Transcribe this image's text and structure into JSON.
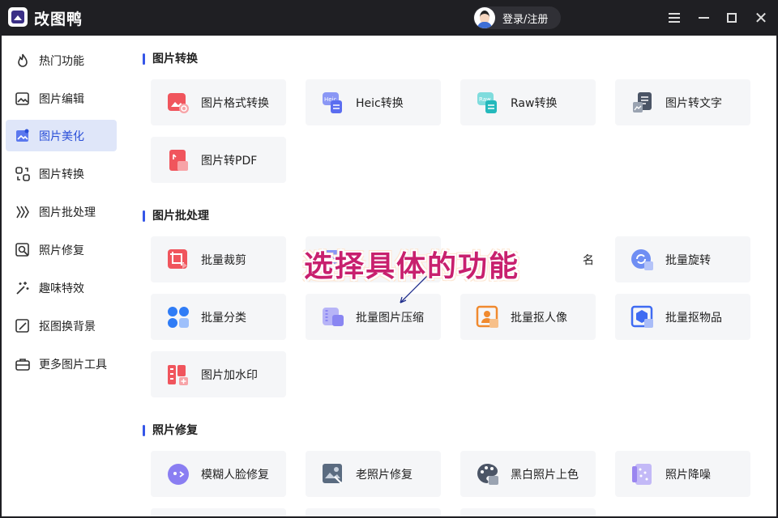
{
  "app": {
    "title": "改图鸭",
    "login_label": "登录/注册"
  },
  "window_controls": [
    "menu-icon",
    "minimize-icon",
    "maximize-icon",
    "close-icon"
  ],
  "sidebar": {
    "items": [
      {
        "label": "热门功能",
        "icon": "flame-icon",
        "active": false
      },
      {
        "label": "图片编辑",
        "icon": "image-edit-icon",
        "active": false
      },
      {
        "label": "图片美化",
        "icon": "image-beautify-icon",
        "active": true
      },
      {
        "label": "图片转换",
        "icon": "image-convert-icon",
        "active": false
      },
      {
        "label": "图片批处理",
        "icon": "batch-icon",
        "active": false
      },
      {
        "label": "照片修复",
        "icon": "photo-repair-icon",
        "active": false
      },
      {
        "label": "趣味特效",
        "icon": "magic-wand-icon",
        "active": false
      },
      {
        "label": "抠图换背景",
        "icon": "cutout-icon",
        "active": false
      },
      {
        "label": "更多图片工具",
        "icon": "toolbox-icon",
        "active": false
      }
    ]
  },
  "sections": [
    {
      "title": "图片转换",
      "cards": [
        {
          "label": "图片格式转换",
          "icon": "format-convert-icon",
          "color": "#f0555d"
        },
        {
          "label": "Heic转换",
          "icon": "heic-icon",
          "color": "#6b7ef0"
        },
        {
          "label": "Raw转换",
          "icon": "raw-icon",
          "color": "#2fc3c6"
        },
        {
          "label": "图片转文字",
          "icon": "image-to-text-icon",
          "color": "#4b5566"
        },
        {
          "label": "图片转PDF",
          "icon": "pdf-icon",
          "color": "#f0555d"
        }
      ]
    },
    {
      "title": "图片批处理",
      "cards": [
        {
          "label": "批量裁剪",
          "icon": "batch-crop-icon",
          "color": "#f0555d"
        },
        {
          "label": "名",
          "icon": "batch-rename-icon",
          "color": "#6b7ef0"
        },
        {
          "label": "批量旋转",
          "icon": "batch-rotate-icon",
          "color": "#5a7ef0"
        },
        {
          "label": "批量分类",
          "icon": "batch-classify-icon",
          "color": "#2f7cf6"
        },
        {
          "label": "批量图片压缩",
          "icon": "batch-compress-icon",
          "color": "#8a86f2"
        },
        {
          "label": "批量抠人像",
          "icon": "batch-portrait-icon",
          "color": "#f08a2f"
        },
        {
          "label": "批量抠物品",
          "icon": "batch-object-icon",
          "color": "#3f6bf2"
        },
        {
          "label": "图片加水印",
          "icon": "watermark-icon",
          "color": "#f0555d"
        }
      ]
    },
    {
      "title": "照片修复",
      "cards": [
        {
          "label": "模糊人脸修复",
          "icon": "face-repair-icon",
          "color": "#8a7ef2"
        },
        {
          "label": "老照片修复",
          "icon": "old-photo-icon",
          "color": "#5a6b80"
        },
        {
          "label": "黑白照片上色",
          "icon": "colorize-icon",
          "color": "#4b5566"
        },
        {
          "label": "照片降噪",
          "icon": "denoise-icon",
          "color": "#9a86f0"
        }
      ]
    }
  ],
  "overlay": {
    "caption": "选择具体的功能"
  },
  "colors": {
    "accent": "#3556e8",
    "annotation": "#c8206e",
    "titlebar": "#1f1f23"
  }
}
